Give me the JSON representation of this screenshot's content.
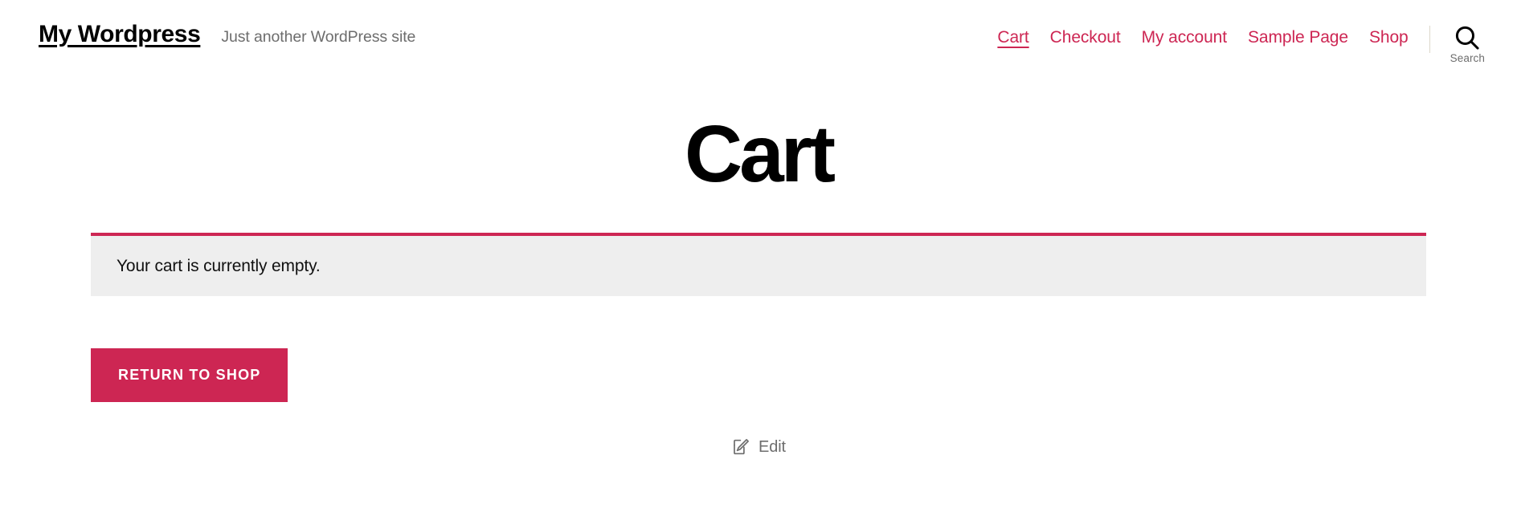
{
  "site": {
    "title": "My Wordpress",
    "tagline": "Just another WordPress site"
  },
  "header": {
    "nav": [
      {
        "label": "Cart",
        "current": true
      },
      {
        "label": "Checkout",
        "current": false
      },
      {
        "label": "My account",
        "current": false
      },
      {
        "label": "Sample Page",
        "current": false
      },
      {
        "label": "Shop",
        "current": false
      }
    ],
    "search": {
      "icon": "search-icon",
      "label": "Search"
    },
    "divider": "nav-divider"
  },
  "page": {
    "title": "Cart"
  },
  "cart": {
    "notice": "Your cart is currently empty.",
    "return_button": "Return to shop"
  },
  "footer": {
    "edit": {
      "icon": "edit-pencil-icon",
      "label": "Edit"
    }
  },
  "colors": {
    "accent": "#cd2653",
    "notice_background": "#eeeeee",
    "text": "#000000",
    "muted_text": "#6d6d6d",
    "divider": "#dcd7ca"
  }
}
